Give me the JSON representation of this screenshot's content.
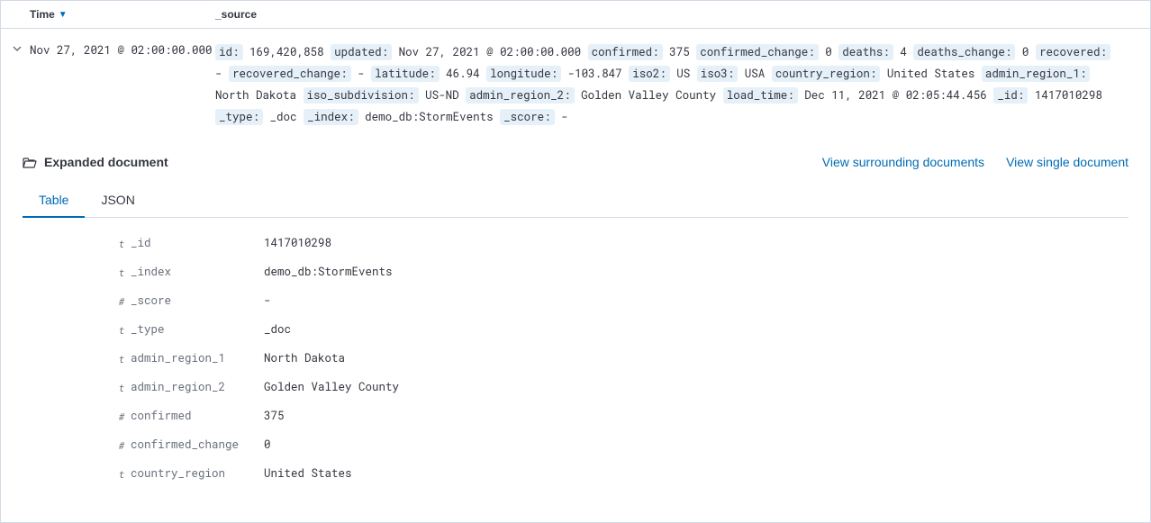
{
  "headers": {
    "time": "Time",
    "source": "_source"
  },
  "row": {
    "timestamp": "Nov 27, 2021 @ 02:00:00.000",
    "fields": [
      {
        "key": "id:",
        "val": "169,420,858"
      },
      {
        "key": "updated:",
        "val": "Nov 27, 2021 @ 02:00:00.000"
      },
      {
        "key": "confirmed:",
        "val": "375"
      },
      {
        "key": "confirmed_change:",
        "val": "0"
      },
      {
        "key": "deaths:",
        "val": "4"
      },
      {
        "key": "deaths_change:",
        "val": "0"
      },
      {
        "key": "recovered:",
        "val": " - "
      },
      {
        "key": "recovered_change:",
        "val": " - "
      },
      {
        "key": "latitude:",
        "val": "46.94"
      },
      {
        "key": "longitude:",
        "val": "-103.847"
      },
      {
        "key": "iso2:",
        "val": "US"
      },
      {
        "key": "iso3:",
        "val": "USA"
      },
      {
        "key": "country_region:",
        "val": "United States"
      },
      {
        "key": "admin_region_1:",
        "val": "North Dakota"
      },
      {
        "key": "iso_subdivision:",
        "val": "US-ND"
      },
      {
        "key": "admin_region_2:",
        "val": "Golden Valley County"
      },
      {
        "key": "load_time:",
        "val": "Dec 11, 2021 @ 02:05:44.456"
      },
      {
        "key": "_id:",
        "val": "1417010298"
      },
      {
        "key": "_type:",
        "val": "_doc"
      },
      {
        "key": "_index:",
        "val": "demo_db:StormEvents"
      },
      {
        "key": "_score:",
        "val": " - "
      }
    ]
  },
  "expanded": {
    "title": "Expanded document",
    "links": {
      "surrounding": "View surrounding documents",
      "single": "View single document"
    },
    "tabs": {
      "table": "Table",
      "json": "JSON"
    },
    "fields": [
      {
        "type": "t",
        "name": "_id",
        "value": "1417010298"
      },
      {
        "type": "t",
        "name": "_index",
        "value": "demo_db:StormEvents"
      },
      {
        "type": "#",
        "name": "_score",
        "value": " - "
      },
      {
        "type": "t",
        "name": "_type",
        "value": "_doc"
      },
      {
        "type": "t",
        "name": "admin_region_1",
        "value": "North Dakota"
      },
      {
        "type": "t",
        "name": "admin_region_2",
        "value": "Golden Valley County"
      },
      {
        "type": "#",
        "name": "confirmed",
        "value": "375"
      },
      {
        "type": "#",
        "name": "confirmed_change",
        "value": "0"
      },
      {
        "type": "t",
        "name": "country_region",
        "value": "United States"
      }
    ]
  }
}
